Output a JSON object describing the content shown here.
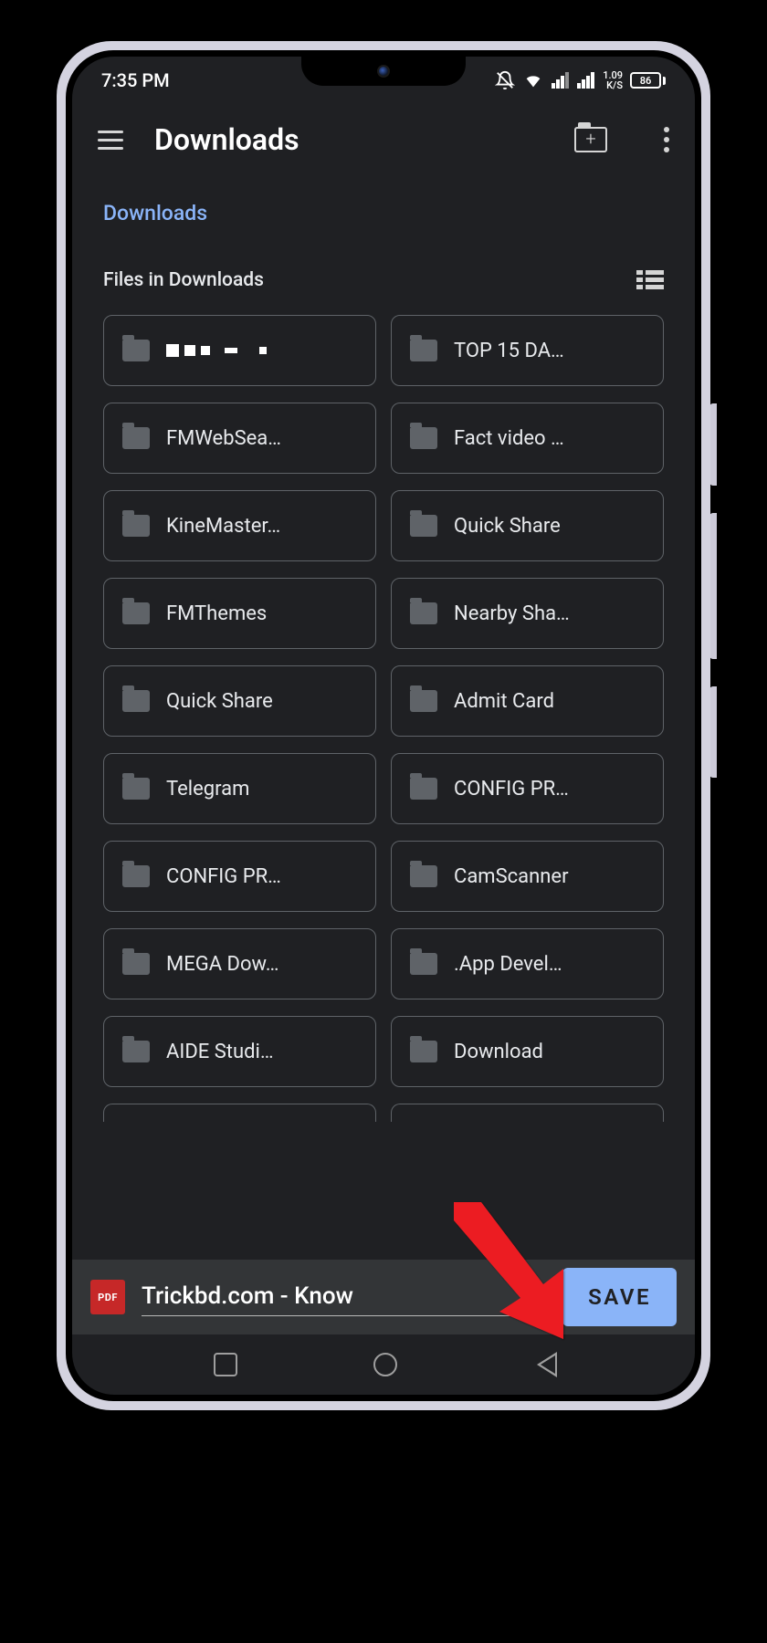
{
  "status_bar": {
    "time": "7:35 PM",
    "speed_value": "1.09",
    "speed_unit": "K/S",
    "battery": "86"
  },
  "header": {
    "title": "Downloads"
  },
  "breadcrumb": {
    "link": "Downloads"
  },
  "section": {
    "title": "Files in Downloads"
  },
  "folders": [
    {
      "label": ""
    },
    {
      "label": "TOP 15 DA…"
    },
    {
      "label": "FMWebSea…"
    },
    {
      "label": "Fact video …"
    },
    {
      "label": "KineMaster…"
    },
    {
      "label": "Quick Share"
    },
    {
      "label": "FMThemes"
    },
    {
      "label": "Nearby Sha…"
    },
    {
      "label": "Quick Share"
    },
    {
      "label": "Admit Card"
    },
    {
      "label": "Telegram"
    },
    {
      "label": "CONFIG PR…"
    },
    {
      "label": "CONFIG PR…"
    },
    {
      "label": "CamScanner"
    },
    {
      "label": "MEGA Dow…"
    },
    {
      "label": ".App Devel…"
    },
    {
      "label": "AIDE Studi…"
    },
    {
      "label": "Download"
    }
  ],
  "save_bar": {
    "file_type": "PDF",
    "filename": "Trickbd.com - Know",
    "save_label": "SAVE"
  }
}
